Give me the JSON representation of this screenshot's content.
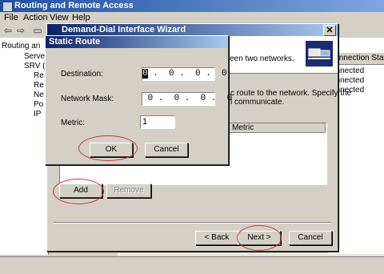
{
  "app": {
    "title": "Routing and Remote Access"
  },
  "menu": [
    "File",
    "Action",
    "View",
    "Help"
  ],
  "tree": {
    "items": [
      "Routing an",
      "Server",
      "SRV (lo",
      "Re",
      "Re",
      "Ne",
      "Po",
      "IP"
    ]
  },
  "right_pane": {
    "column": "Connection State",
    "rows": [
      "onnected",
      "onnected",
      "onnected"
    ]
  },
  "wizard": {
    "title": "Demand-Dial Interface Wizard",
    "header_text": "een two networks.",
    "body_line1": "c route to the network. Specify the",
    "body_line2": "l communicate.",
    "list_columns": [
      "Metric"
    ],
    "add_label": "Add",
    "remove_label": "Remove",
    "back_label": "< Back",
    "next_label": "Next >",
    "cancel_label": "Cancel"
  },
  "dialog": {
    "title": "Static Route",
    "destination_label": "Destination:",
    "destination_first": "0",
    "destination_rest": " .  0 .  0 .  0",
    "mask_label": "Network Mask:",
    "mask_value": " 0 .  0 .  0 .  0",
    "metric_label": "Metric:",
    "metric_value": "1",
    "ok_label": "OK",
    "cancel_label": "Cancel"
  },
  "colors": {
    "highlight": "#c23a3a",
    "title_active": "#0a246a"
  }
}
